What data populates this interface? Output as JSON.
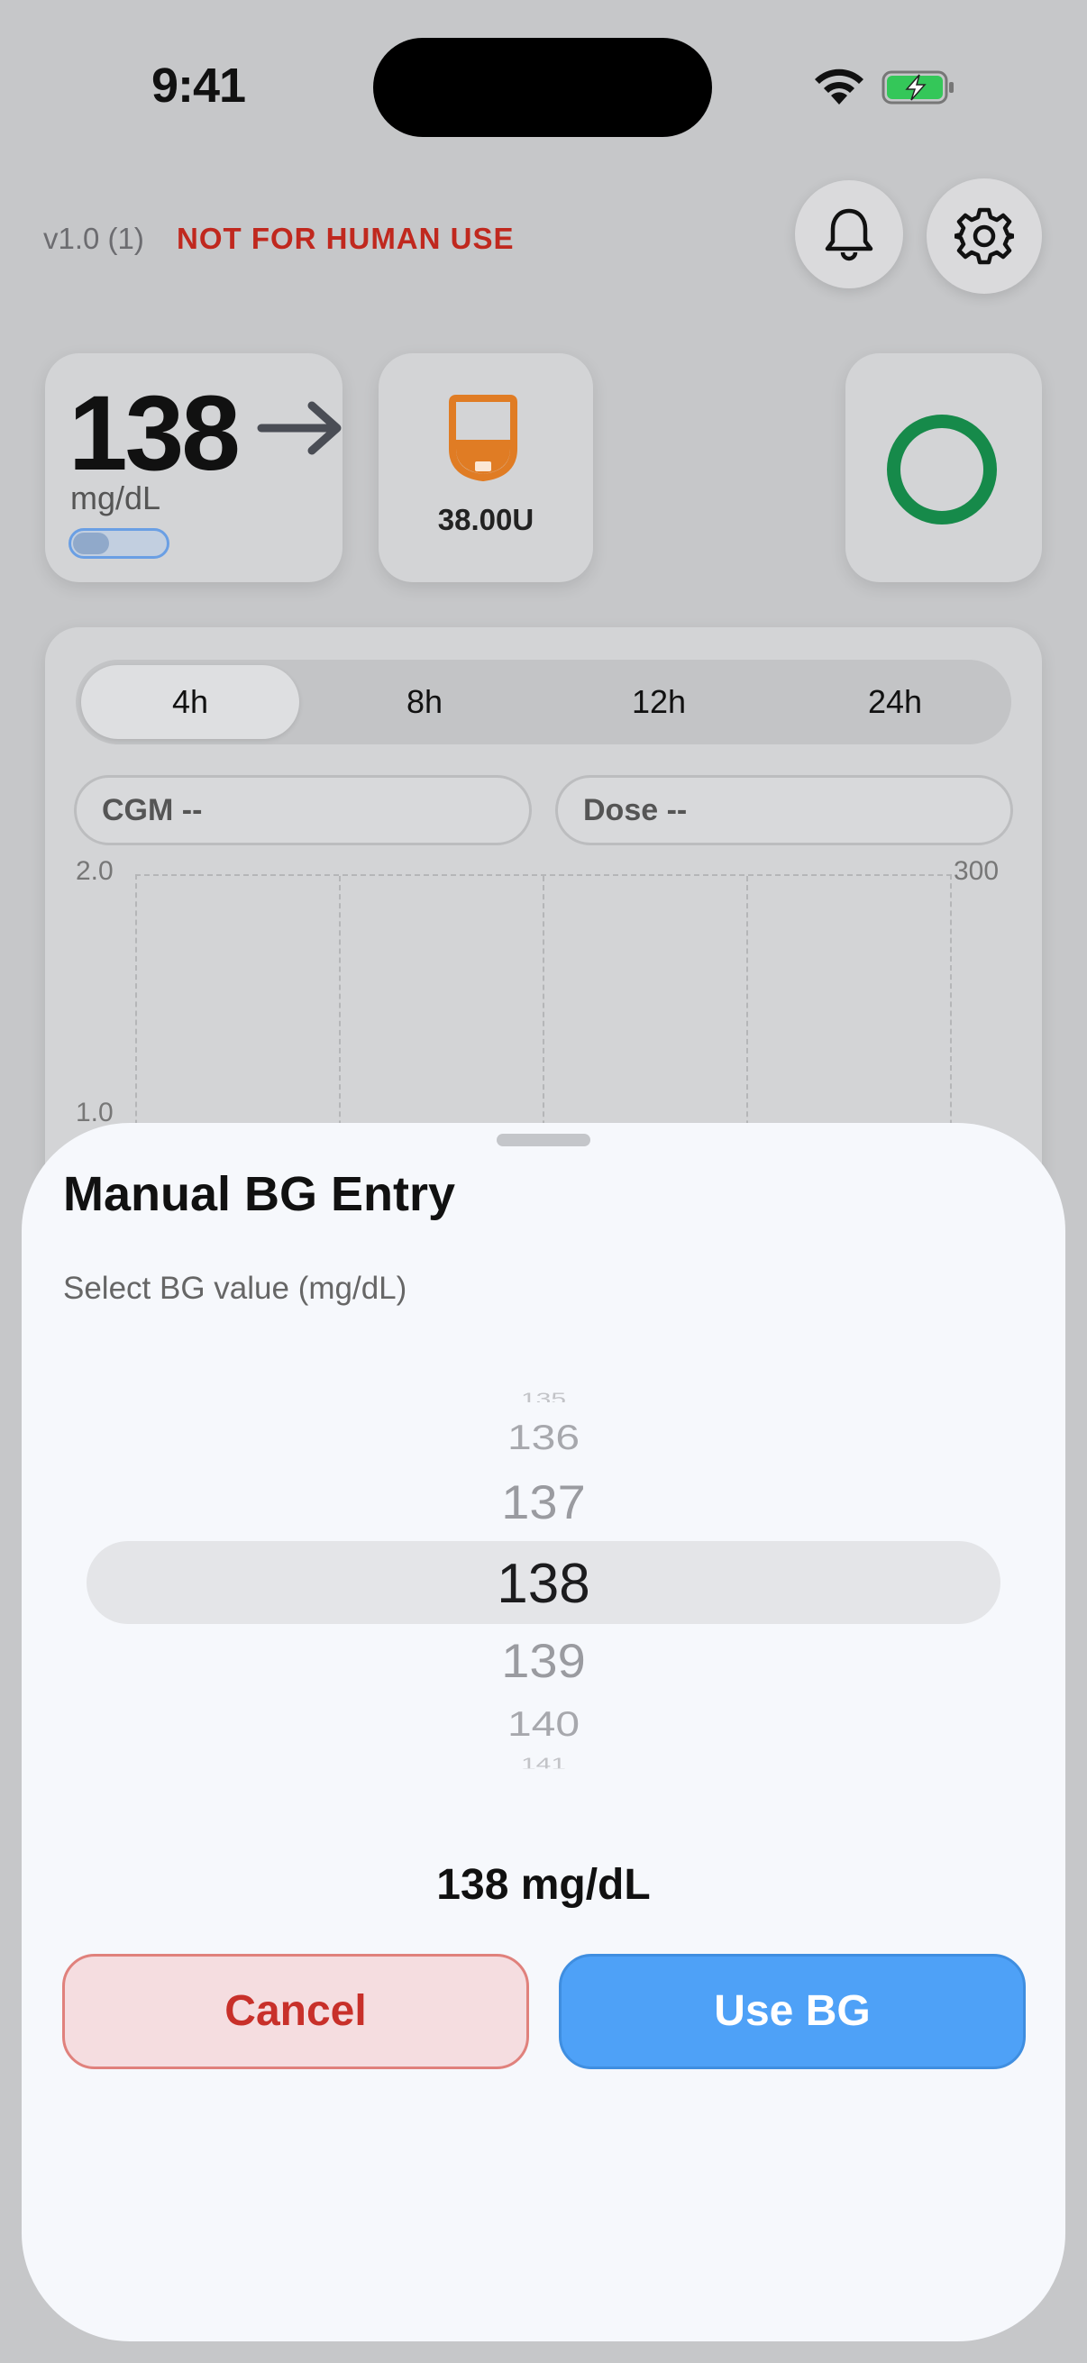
{
  "status_bar": {
    "time": "9:41"
  },
  "header": {
    "version": "v1.0 (1)",
    "warning": "NOT FOR HUMAN USE",
    "warning_color": "#c0281e"
  },
  "glucose_card": {
    "value": "138",
    "unit": "mg/dL",
    "trend_icon": "arrow-right-icon"
  },
  "pod_card": {
    "reservoir": "38.00U",
    "icon": "pod-icon",
    "color": "#e07c24"
  },
  "loop_card": {
    "status_color": "#168a4a"
  },
  "chart": {
    "ranges": [
      "4h",
      "8h",
      "12h",
      "24h"
    ],
    "selected_range": "4h",
    "cgm_pill": "CGM  --",
    "dose_pill": "Dose  --",
    "left_axis_top": "2.0",
    "left_axis_mid": "1.0",
    "right_axis_top": "300"
  },
  "sheet": {
    "title": "Manual BG Entry",
    "subtitle": "Select BG value (mg/dL)",
    "picker_values": [
      "135",
      "136",
      "137",
      "138",
      "139",
      "140",
      "141"
    ],
    "selected_value": "138",
    "readout": "138 mg/dL",
    "cancel_label": "Cancel",
    "use_label": "Use BG",
    "accent_color": "#4ea1f7",
    "cancel_color": "#c8302a"
  }
}
